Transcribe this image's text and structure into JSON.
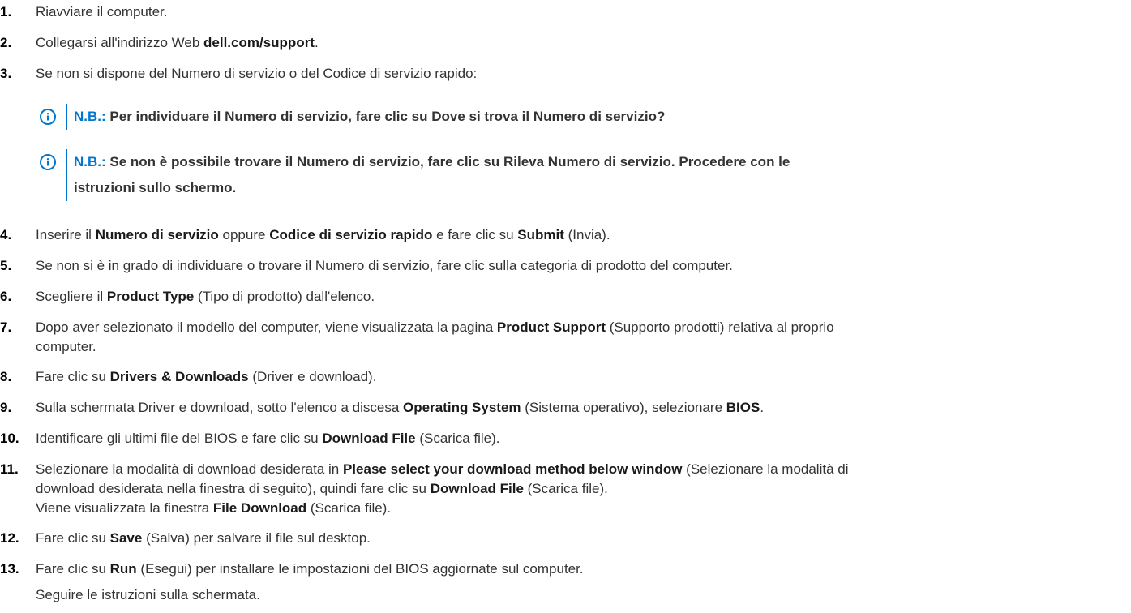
{
  "steps": [
    {
      "n": "1.",
      "parts": [
        "Riavviare il computer."
      ]
    },
    {
      "n": "2.",
      "pre": "Collegarsi all'indirizzo Web ",
      "b1": "dell.com/support",
      "post": "."
    },
    {
      "n": "3.",
      "text": "Se non si dispone del Numero di servizio o del Codice di servizio rapido:"
    },
    {
      "n": "4.",
      "t1": "Inserire il ",
      "b1": "Numero di servizio",
      "t2": " oppure ",
      "b2": "Codice di servizio rapido",
      "t3": " e fare clic su ",
      "b3": "Submit",
      "t4": " (Invia)."
    },
    {
      "n": "5.",
      "text": "Se non si è in grado di individuare o trovare il Numero di servizio, fare clic sulla categoria di prodotto del computer."
    },
    {
      "n": "6.",
      "t1": "Scegliere il ",
      "b1": "Product Type",
      "t2": " (Tipo di prodotto) dall'elenco."
    },
    {
      "n": "7.",
      "t1": "Dopo aver selezionato il modello del computer, viene visualizzata la pagina ",
      "b1": "Product Support",
      "t2": " (Supporto prodotti) relativa al proprio",
      "t3": "computer."
    },
    {
      "n": "8.",
      "t1": "Fare clic su ",
      "b1": "Drivers & Downloads",
      "t2": " (Driver e download)."
    },
    {
      "n": "9.",
      "t1": "Sulla schermata Driver e download, sotto l'elenco a discesa ",
      "b1": "Operating System",
      "t2": " (Sistema operativo), selezionare ",
      "b2": "BIOS",
      "t3": "."
    },
    {
      "n": "10.",
      "t1": "Identificare gli ultimi file del BIOS e fare clic su ",
      "b1": "Download File",
      "t2": " (Scarica file)."
    },
    {
      "n": "11.",
      "t1": "Selezionare la modalità di download desiderata in ",
      "b1": "Please select your download method below window",
      "t2": " (Selezionare la modalità di",
      "t3": "download desiderata nella finestra di seguito), quindi fare clic su ",
      "b2": "Download File",
      "t4": " (Scarica file).",
      "t5": "Viene visualizzata la finestra ",
      "b3": "File Download",
      "t6": " (Scarica file)."
    },
    {
      "n": "12.",
      "t1": "Fare clic su ",
      "b1": "Save",
      "t2": " (Salva) per salvare il file sul desktop."
    },
    {
      "n": "13.",
      "t1": "Fare clic su ",
      "b1": "Run",
      "t2": " (Esegui) per installare le impostazioni del BIOS aggiornate sul computer.",
      "t3": "Seguire le istruzioni sulla schermata."
    }
  ],
  "notes": [
    {
      "label": "N.B.:",
      "text": " Per individuare il Numero di servizio, fare clic su Dove si trova il Numero di servizio?"
    },
    {
      "label": "N.B.:",
      "text": " Se non è possibile trovare il Numero di servizio, fare clic su Rileva Numero di servizio. Procedere con le",
      "text2": "istruzioni sullo schermo."
    }
  ],
  "icon": {
    "name": "info-icon",
    "color": "#0076ce"
  }
}
